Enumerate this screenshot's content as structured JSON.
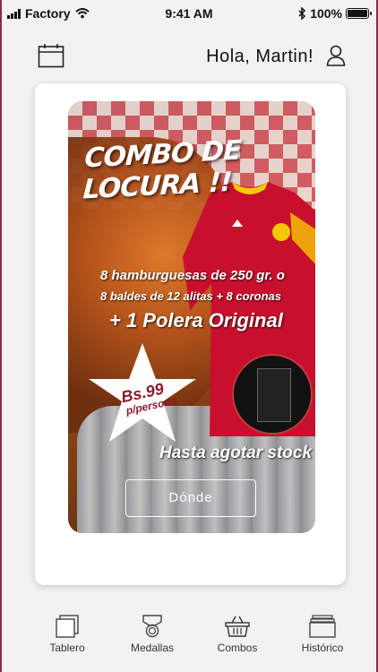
{
  "status_bar": {
    "carrier": "Factory",
    "time": "9:41 AM",
    "battery": "100%"
  },
  "header": {
    "greeting": "Hola, Martin!"
  },
  "promo": {
    "title": "COMBO DE LOCURA !!",
    "line1": "8 hamburguesas de 250 gr. o",
    "line2": "8 baldes de 12 alitas + 8 coronas",
    "line3": "+ 1 Polera Original",
    "price": "Bs.99",
    "price_unit": "p/persona",
    "stock": "Hasta agotar stock",
    "button_label": "Dónde"
  },
  "tabs": [
    {
      "label": "Tablero",
      "icon": "square-stack-icon"
    },
    {
      "label": "Medallas",
      "icon": "medal-icon"
    },
    {
      "label": "Combos",
      "icon": "basket-icon"
    },
    {
      "label": "Histórico",
      "icon": "archive-icon"
    }
  ],
  "colors": {
    "accent": "#8b2a4a",
    "promo_price": "#8a1c2c"
  }
}
